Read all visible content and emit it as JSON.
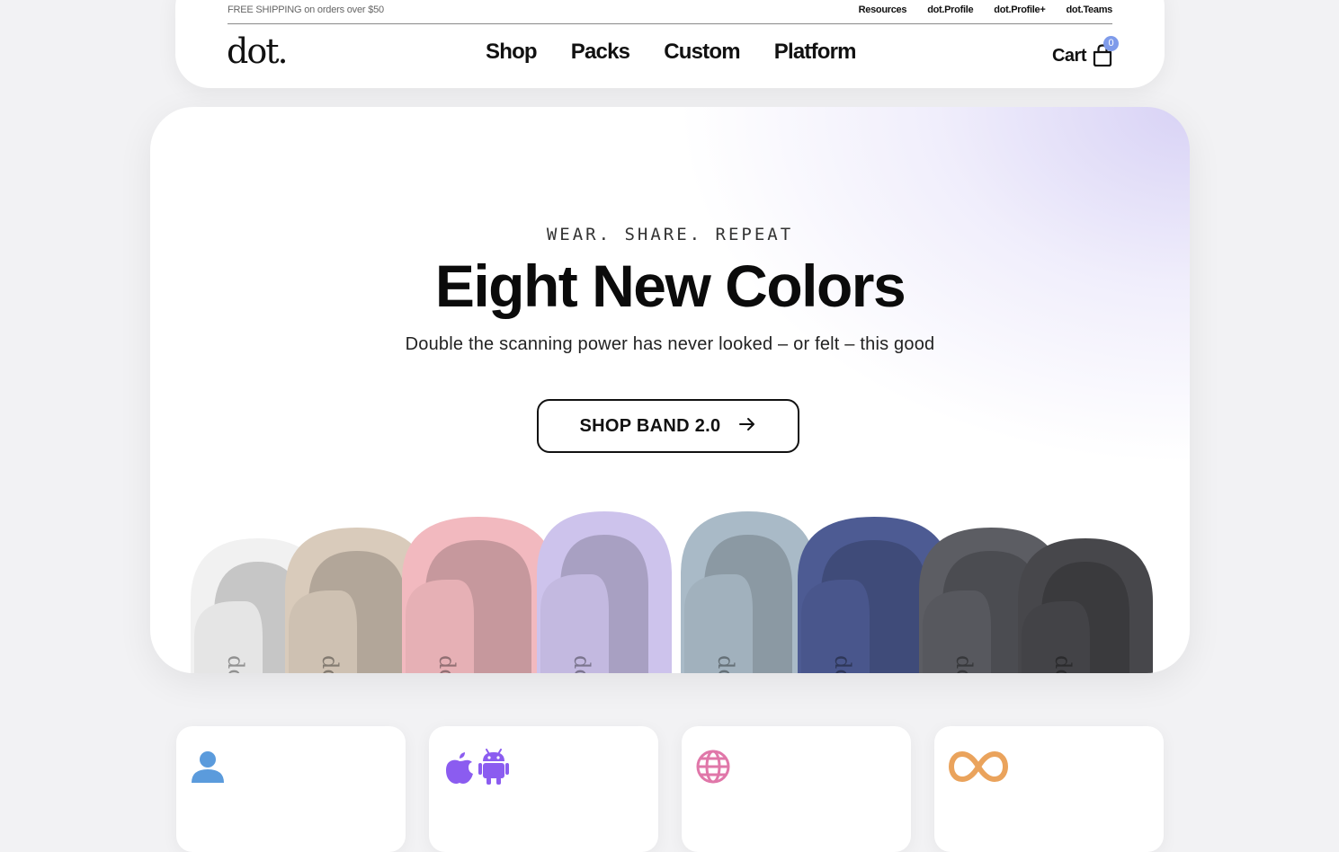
{
  "topbar": {
    "shipping_text": "FREE SHIPPING on orders over $50",
    "links": [
      "Resources",
      "dot.Profile",
      "dot.Profile+",
      "dot.Teams"
    ]
  },
  "header": {
    "logo": "dot.",
    "nav": [
      "Shop",
      "Packs",
      "Custom",
      "Platform"
    ],
    "cart_label": "Cart",
    "cart_count": "0"
  },
  "hero": {
    "eyebrow": "WEAR. SHARE. REPEAT",
    "title": "Eight New Colors",
    "subtitle": "Double the scanning power has never looked – or felt – this good",
    "cta_label": "SHOP BAND 2.0",
    "band_colors": [
      "#f1f1f1",
      "#d9cbbb",
      "#f2b9bf",
      "#cdc3ec",
      "#a9bac7",
      "#4d5b93",
      "#5c5d63",
      "#47474b"
    ],
    "band_brand": "dot."
  },
  "features": [
    {
      "icon": "user-icon",
      "color": "#5b9bdc"
    },
    {
      "icon": "apple-android-icon",
      "color": "#8b5cf0"
    },
    {
      "icon": "globe-icon",
      "color": "#e077a9"
    },
    {
      "icon": "infinity-icon",
      "color": "#eaa35c"
    }
  ]
}
